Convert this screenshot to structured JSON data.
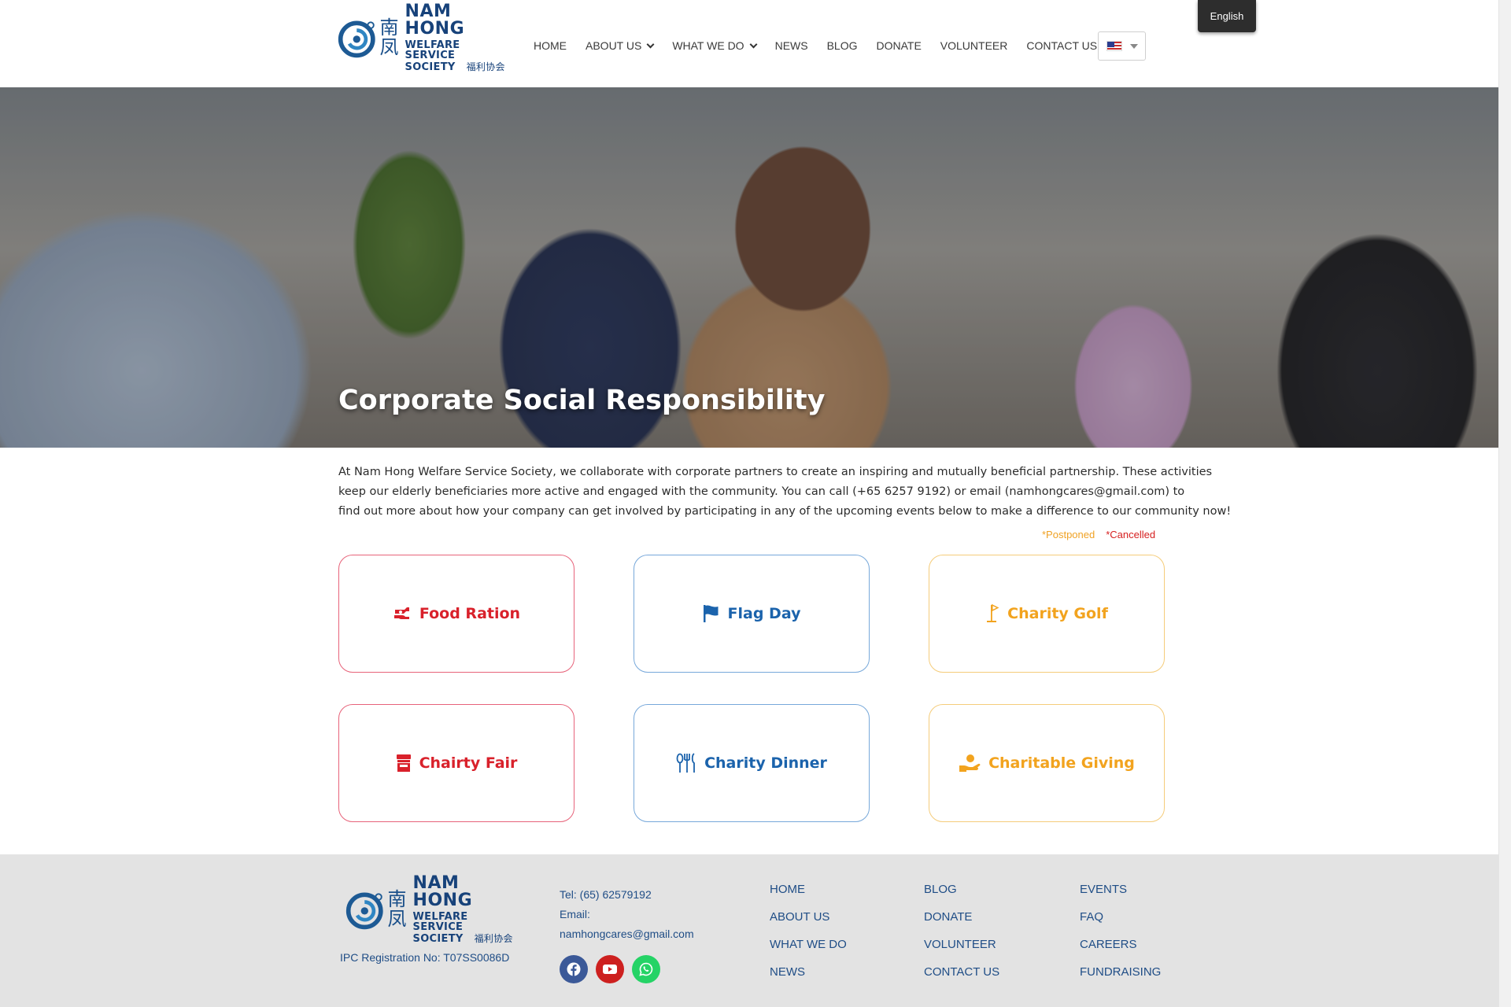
{
  "header": {
    "logo": {
      "cn_top": "南",
      "cn_bottom": "凤",
      "name": "NAM HONG",
      "line2": "WELFARE SERVICE",
      "line3": "SOCIETY",
      "line3_cn": "福利协会"
    },
    "nav": [
      {
        "label": "HOME",
        "dropdown": false
      },
      {
        "label": "ABOUT US",
        "dropdown": true
      },
      {
        "label": "WHAT WE DO",
        "dropdown": true
      },
      {
        "label": "NEWS",
        "dropdown": false
      },
      {
        "label": "BLOG",
        "dropdown": false
      },
      {
        "label": "DONATE",
        "dropdown": false
      },
      {
        "label": "VOLUNTEER",
        "dropdown": false
      },
      {
        "label": "CONTACT US",
        "dropdown": false
      }
    ],
    "language": {
      "flag": "us-flag-icon",
      "tooltip": "English"
    }
  },
  "hero": {
    "title": "Corporate Social Responsibility"
  },
  "intro": {
    "line1": "At Nam Hong Welfare Service Society, we collaborate with corporate partners to create an inspiring and mutually beneficial partnership. These activities",
    "line2": "keep our elderly beneficiaries more active and engaged with the community.  You can call (+65 6257 9192) or email (namhongcares@gmail.com) to",
    "line3": "find out more about how your company can get involved by participating in any of the upcoming events below to make a difference to our community now!"
  },
  "legend": {
    "postponed": "*Postponed",
    "cancelled": "*Cancelled"
  },
  "colors": {
    "red": "#d9212b",
    "blue": "#1b63ac",
    "orange": "#f2a31e",
    "navy": "#1f4d86"
  },
  "cards": [
    {
      "label": "Food Ration",
      "icon": "food-ration-icon",
      "color": "red"
    },
    {
      "label": "Flag Day",
      "icon": "flag-icon",
      "color": "blue"
    },
    {
      "label": "Charity Golf",
      "icon": "golf-icon",
      "color": "orange"
    },
    {
      "label": "Chairty Fair",
      "icon": "fair-stall-icon",
      "color": "red"
    },
    {
      "label": "Charity Dinner",
      "icon": "utensils-icon",
      "color": "blue"
    },
    {
      "label": "Charitable Giving",
      "icon": "hand-giving-icon",
      "color": "orange"
    }
  ],
  "footer": {
    "ipc": "IPC Registration No: T07SS0086D",
    "tel": "Tel: (65) 62579192",
    "email_label": "Email:",
    "email": "namhongcares@gmail.com",
    "socials": [
      "facebook-icon",
      "youtube-icon",
      "whatsapp-icon"
    ],
    "col1": [
      "HOME",
      "ABOUT US",
      "WHAT WE DO",
      "NEWS"
    ],
    "col2": [
      "BLOG",
      "DONATE",
      "VOLUNTEER",
      "CONTACT US"
    ],
    "col3": [
      "EVENTS",
      "FAQ",
      "CAREERS",
      "FUNDRAISING"
    ]
  }
}
